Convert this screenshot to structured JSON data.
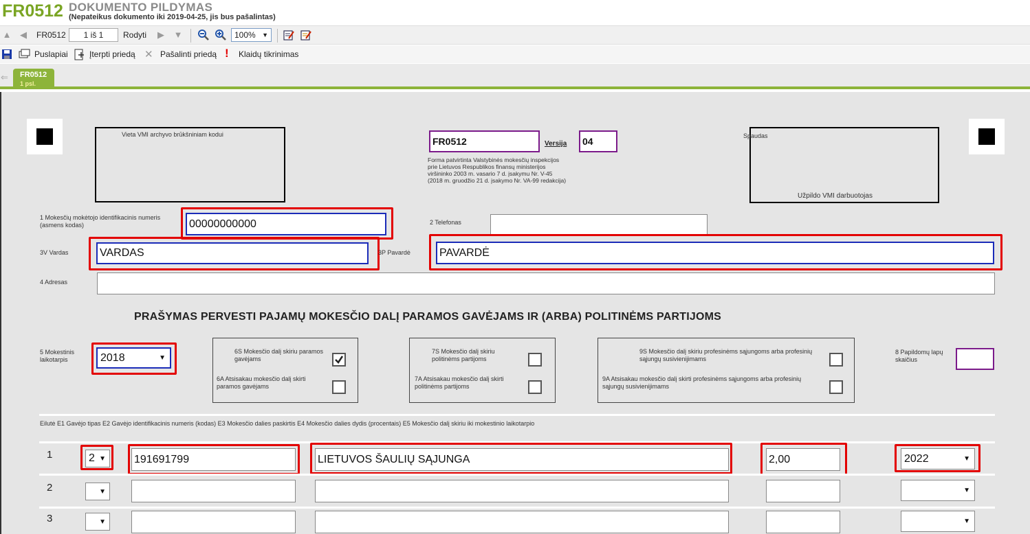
{
  "header": {
    "code": "FR0512",
    "title": "DOKUMENTO PILDYMAS",
    "subtitle": "(Nepateikus dokumento iki 2019-04-25, jis bus pašalintas)"
  },
  "toolbar": {
    "form_code": "FR0512",
    "page_indicator": "1 iš 1",
    "show_label": "Rodyti",
    "zoom": "100%"
  },
  "toolbar2": {
    "pages": "Puslapiai",
    "insert_attachment": "Įterpti priedą",
    "remove_attachment": "Pašalinti priedą",
    "error_check": "Klaidų tikrinimas"
  },
  "tab": {
    "name": "FR0512",
    "page": "1 psl."
  },
  "form": {
    "archive_label": "Vieta VMI archyvo brūkšniniam kodui",
    "form_code": "FR0512",
    "version_label": "Versija",
    "version_value": "04",
    "approval_text": "Forma patvirtinta Valstybinės mokesčių inspekcijos\nprie Lietuvos Respublikos finansų ministerijos\nviršininko 2003 m. vasario 7 d. įsakymu Nr. V-45\n(2018 m. gruodžio 21 d. įsakymo Nr. VA-99 redakcija)",
    "stamp_label": "Spaudas",
    "stamp_footer": "Užpildo VMI darbuotojas",
    "f1_label": "1 Mokesčių mokėtojo identifikacinis numeris (asmens kodas)",
    "f1_value": "00000000000",
    "f2_label": "2 Telefonas",
    "f2_value": "",
    "f3v_label": "3V Vardas",
    "f3v_value": "VARDAS",
    "f3p_label": "3P Pavardė",
    "f3p_value": "PAVARDĖ",
    "f4_label": "4 Adresas",
    "f4_value": "",
    "heading": "PRAŠYMAS PERVESTI PAJAMŲ MOKESČIO DALĮ PARAMOS GAVĖJAMS IR (ARBA) POLITINĖMS PARTIJOMS",
    "f5_label": "5 Mokestinis laikotarpis",
    "f5_value": "2018",
    "f6s_label": "6S Mokesčio dalį skiriu paramos gavėjams",
    "f6s_checked": true,
    "f6a_label": "6A Atsisakau mokesčio dalį skirti paramos gavėjams",
    "f7s_label": "7S Mokesčio dalį skiriu politinėms partijoms",
    "f7a_label": "7A Atsisakau mokesčio dalį skirti politinėms partijoms",
    "f9s_label": "9S Mokesčio dalį skiriu profesinėms sąjungoms arba profesinių sąjungų susivienijimams",
    "f9a_label": "9A Atsisakau mokesčio dalį skirti profesinėms sąjungoms arba profesinių sąjungų susivienijimams",
    "f8_label": "8 Papildomų lapų skaičius",
    "f8_value": "",
    "table_header": "Eilutė E1 Gavėjo tipas E2 Gavėjo identifikacinis numeris (kodas) E3 Mokesčio dalies paskirtis E4 Mokesčio dalies dydis (procentais) E5 Mokesčio dalį skiriu iki mokestinio laikotarpio"
  },
  "rows": [
    {
      "num": "1",
      "type": "2",
      "id": "191691799",
      "purpose": "LIETUVOS ŠAULIŲ SĄJUNGA",
      "percent": "2,00",
      "year": "2022"
    },
    {
      "num": "2",
      "type": "",
      "id": "",
      "purpose": "",
      "percent": "",
      "year": ""
    },
    {
      "num": "3",
      "type": "",
      "id": "",
      "purpose": "",
      "percent": "",
      "year": ""
    }
  ],
  "colors": {
    "brand_green": "#7aa524",
    "tab_green": "#8db43a",
    "highlight_red": "#e30000",
    "field_blue": "#1a2bb8",
    "field_purple": "#7b1a8a"
  }
}
